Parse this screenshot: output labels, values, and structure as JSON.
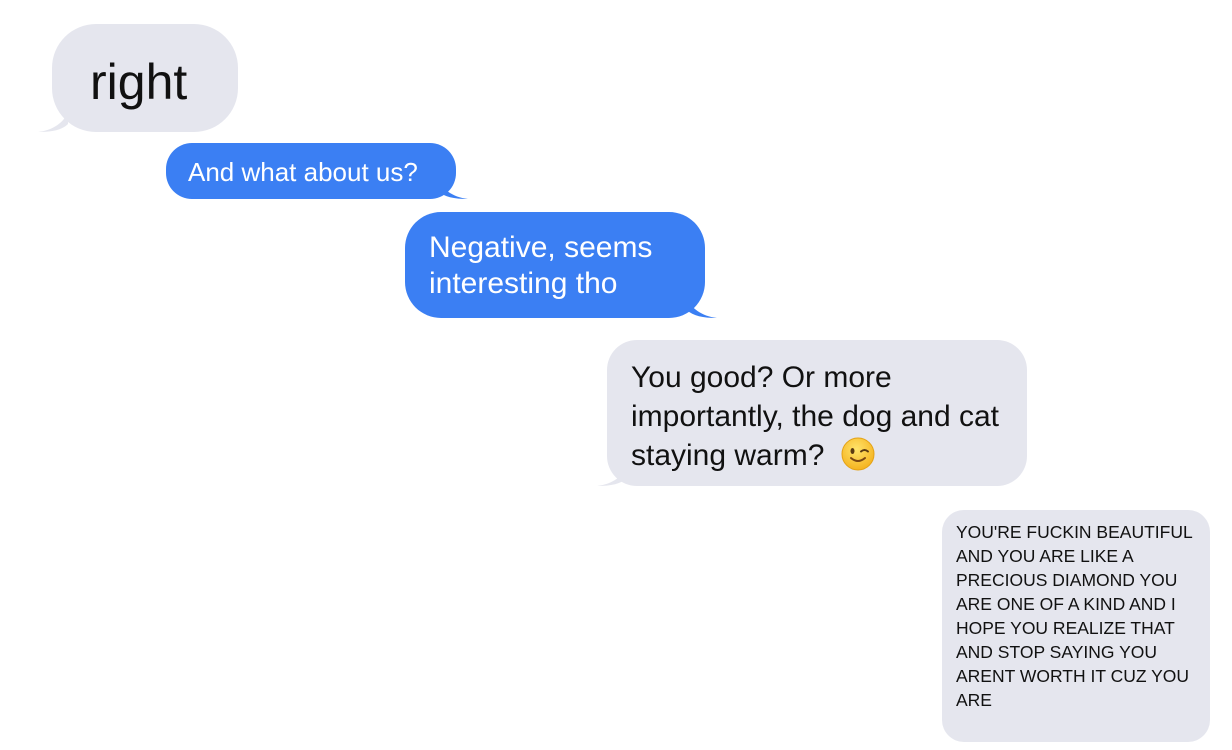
{
  "messages": [
    {
      "sender": "them",
      "text": "right"
    },
    {
      "sender": "me",
      "text": "And what about us?"
    },
    {
      "sender": "me",
      "text": "Negative, seems interesting tho"
    },
    {
      "sender": "them",
      "text": "You good? Or more importantly, the dog and cat staying warm?",
      "emoji": "winking-face-icon"
    },
    {
      "sender": "them",
      "text": "YOU'RE FUCKIN BEAUTIFUL AND YOU ARE LIKE A PRECIOUS DIAMOND YOU ARE ONE OF A KIND AND I HOPE YOU REALIZE THAT AND STOP SAYING YOU ARENT WORTH IT CUZ YOU ARE"
    }
  ],
  "colors": {
    "incoming_bubble": "#e5e6ee",
    "outgoing_bubble": "#3b7ff3",
    "incoming_text": "#111111",
    "outgoing_text": "#ffffff",
    "background": "#ffffff"
  }
}
